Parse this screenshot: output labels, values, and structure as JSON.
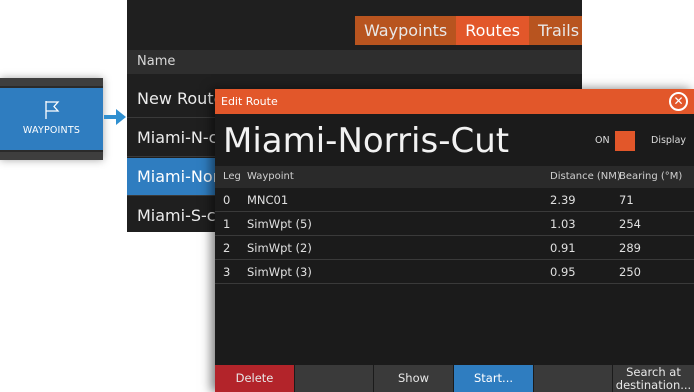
{
  "waypoints_tile": {
    "label": "WAYPOINTS",
    "icon": "flag-icon"
  },
  "list_window": {
    "tabs": [
      {
        "label": "Waypoints",
        "active": false
      },
      {
        "label": "Routes",
        "active": true
      },
      {
        "label": "Trails",
        "active": false
      }
    ],
    "column_header": "Name",
    "routes": [
      "New Route",
      "Miami-N-cut",
      "Miami-Norris-Cut",
      "Miami-S-cut"
    ],
    "selected_index": 2
  },
  "dialog": {
    "title": "Edit Route",
    "route_name": "Miami-Norris-Cut",
    "on_label": "ON",
    "display_label": "Display",
    "columns": {
      "leg": "Leg",
      "waypoint": "Waypoint",
      "distance": "Distance (NM)",
      "bearing": "Bearing (°M)"
    },
    "rows": [
      {
        "leg": "0",
        "waypoint": "MNC01",
        "distance": "2.39",
        "bearing": "71"
      },
      {
        "leg": "1",
        "waypoint": "SimWpt (5)",
        "distance": "1.03",
        "bearing": "254"
      },
      {
        "leg": "2",
        "waypoint": "SimWpt (2)",
        "distance": "0.91",
        "bearing": "289"
      },
      {
        "leg": "3",
        "waypoint": "SimWpt (3)",
        "distance": "0.95",
        "bearing": "250"
      }
    ],
    "footer": {
      "delete": "Delete",
      "show": "Show",
      "start": "Start...",
      "search": "Search at destination..."
    }
  },
  "colors": {
    "accent": "#e2572a",
    "selection": "#2f7dc0",
    "delete": "#b3242a",
    "panel": "#1b1b1b"
  }
}
